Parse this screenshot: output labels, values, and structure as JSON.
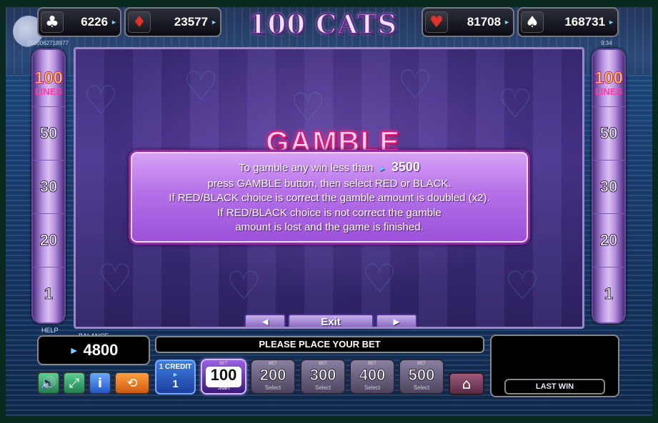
{
  "header": {
    "title": "100 CATS",
    "jackpots": [
      {
        "suit": "clubs",
        "symbol": "♣",
        "value": "6226"
      },
      {
        "suit": "diamonds",
        "symbol": "♦",
        "value": "23577"
      },
      {
        "suit": "hearts",
        "symbol": "♥",
        "value": "81708"
      },
      {
        "suit": "spades",
        "symbol": "♠",
        "value": "168731"
      }
    ],
    "session_id": "1500062718977",
    "clock": "9:34"
  },
  "lines": {
    "max": "100",
    "label": "LINES",
    "options": [
      "50",
      "30",
      "20",
      "1"
    ]
  },
  "gamble": {
    "title": "GAMBLE",
    "line1_pre": "To gamble any win less than",
    "limit": "3500",
    "line2": "press GAMBLE button, then select RED or BLACK.",
    "line3": "If RED/BLACK choice is correct the gamble amount is doubled (x2).",
    "line4": "If RED/BLACK choice is not correct the gamble",
    "line5": "amount is lost and the game is finished."
  },
  "nav": {
    "prev": "◄",
    "exit": "Exit",
    "next": "►"
  },
  "bottom": {
    "help_label": "HELP",
    "balance_label": "BALANCE",
    "balance": "4800",
    "message": "PLEASE PLACE YOUR BET",
    "last_win_label": "LAST WIN",
    "credit_label": "1 CREDIT",
    "credit_value": "1",
    "bets": [
      {
        "top": "BET",
        "value": "100",
        "sub": "Start",
        "active": true
      },
      {
        "top": "BET",
        "value": "200",
        "sub": "Select",
        "active": false
      },
      {
        "top": "BET",
        "value": "300",
        "sub": "Select",
        "active": false
      },
      {
        "top": "BET",
        "value": "400",
        "sub": "Select",
        "active": false
      },
      {
        "top": "BET",
        "value": "500",
        "sub": "Select",
        "active": false
      }
    ]
  },
  "icons": {
    "sound": "speaker-icon",
    "fullscreen": "fullscreen-icon",
    "info": "info-icon",
    "autoplay": "autoplay-icon",
    "home": "home-icon"
  },
  "colors": {
    "accent_pink": "#e0187a",
    "lines_gold": "#ffd640",
    "credit_blue": "#1a3fa0",
    "sound_green": "#2fa86a",
    "autoplay_orange": "#e8761a"
  }
}
